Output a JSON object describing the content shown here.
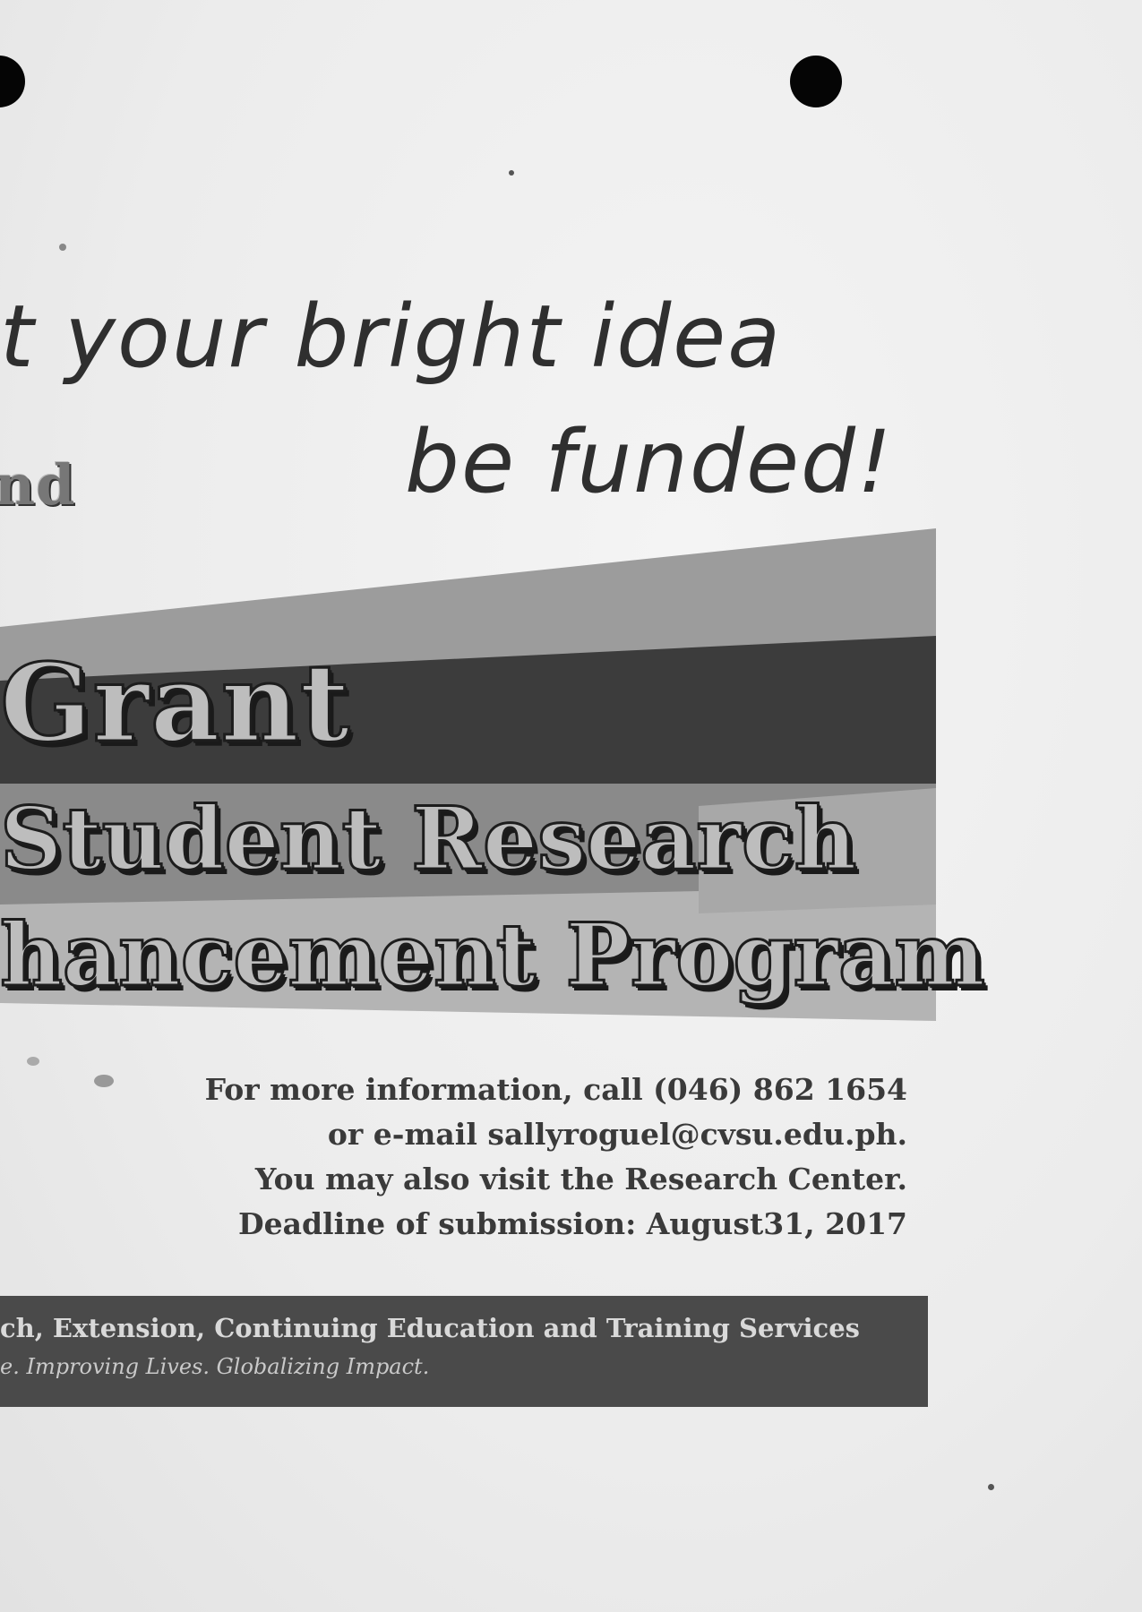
{
  "headline": {
    "line1": "t your bright idea",
    "line2": "be funded!",
    "fragment": "nd"
  },
  "program": {
    "line1": "Grant",
    "line2": "Student Research",
    "line3": "hancement Program"
  },
  "contact": {
    "line1": "For more information, call (046) 862 1654",
    "line2": "or e-mail  sallyroguel@cvsu.edu.ph.",
    "line3": "You may also visit the Research Center.",
    "line4": "Deadline of submission: August31, 2017"
  },
  "footer": {
    "office": "ch, Extension, Continuing Education and Training Services",
    "tagline": "e. Improving Lives. Globalizing Impact."
  },
  "colors": {
    "paper": "#eeeeee",
    "banner_dark": "#3c3c3c",
    "banner_mid": "#8a8a8a",
    "banner_light": "#b4b4b4",
    "footer_bar": "#4a4a4a",
    "punch_hole": "#050505"
  }
}
